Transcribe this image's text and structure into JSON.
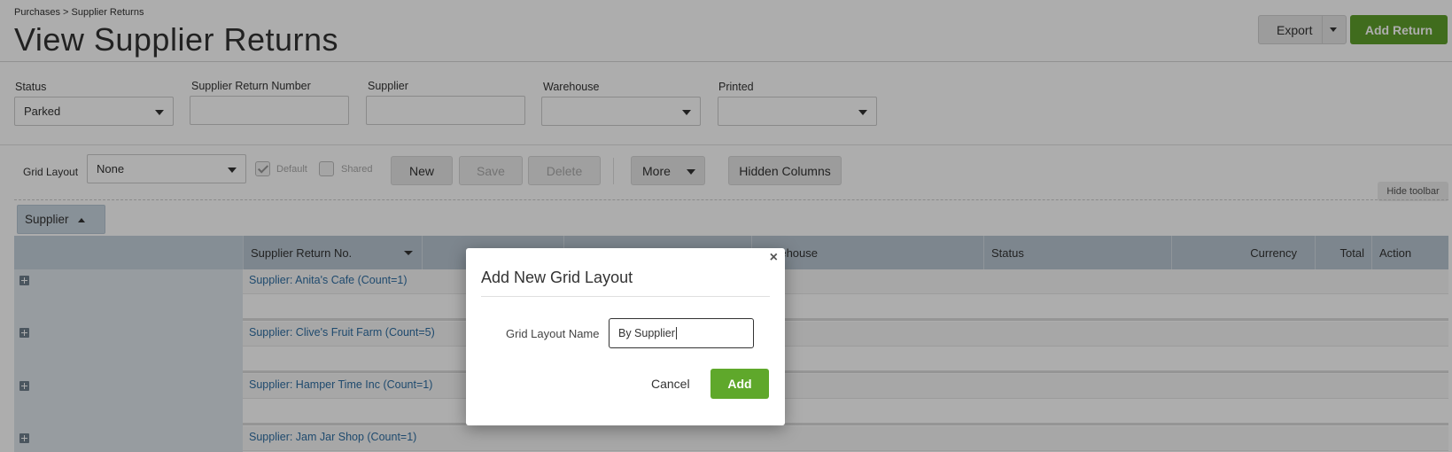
{
  "breadcrumb": "Purchases > Supplier Returns",
  "page_title": "View Supplier Returns",
  "header_buttons": {
    "export": "Export",
    "add_return": "Add Return"
  },
  "filters": {
    "status": {
      "label": "Status",
      "value": "Parked"
    },
    "supplier_return_number": {
      "label": "Supplier Return Number",
      "value": ""
    },
    "supplier": {
      "label": "Supplier",
      "value": ""
    },
    "warehouse": {
      "label": "Warehouse",
      "value": ""
    },
    "printed": {
      "label": "Printed",
      "value": ""
    }
  },
  "toolbar": {
    "grid_layout_label": "Grid Layout",
    "grid_layout_value": "None",
    "default_label": "Default",
    "shared_label": "Shared",
    "new": "New",
    "save": "Save",
    "delete": "Delete",
    "more": "More",
    "hidden_columns": "Hidden Columns",
    "hide_toolbar": "Hide toolbar"
  },
  "group_by": "Supplier",
  "grid": {
    "columns": [
      "Supplier Return No.",
      "",
      "",
      "Warehouse",
      "Status",
      "Currency",
      "Total",
      "Action"
    ],
    "groups": [
      "Supplier: Anita's Cafe (Count=1)",
      "Supplier: Clive's Fruit Farm (Count=5)",
      "Supplier: Hamper Time Inc (Count=1)",
      "Supplier: Jam Jar Shop (Count=1)"
    ]
  },
  "modal": {
    "close": "×",
    "title": "Add New Grid Layout",
    "field_label": "Grid Layout Name",
    "field_value": "By Supplier",
    "cancel": "Cancel",
    "add": "Add"
  },
  "colors": {
    "accent_green": "#5f9f2b",
    "link_blue": "#2e6ea2",
    "header_bg": "#b8c6d1"
  }
}
